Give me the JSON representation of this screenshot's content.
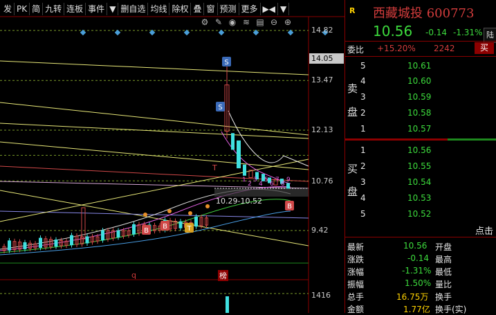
{
  "toolbar": {
    "items": [
      "发",
      "PK",
      "简",
      "九转",
      "连板",
      "事件",
      "▼",
      "删自选",
      "均线",
      "除权",
      "叠",
      "窗",
      "预测",
      "更多",
      "▶◀",
      "▼"
    ]
  },
  "chart_icons": [
    "gear-icon",
    "pen-icon",
    "eye-icon",
    "stack-icon",
    "file-icon",
    "minus-icon",
    "plus-icon"
  ],
  "axis": {
    "price_ticks": [
      {
        "label": "14.82",
        "value": 14.82
      },
      {
        "label": "13.47",
        "value": 13.47
      },
      {
        "label": "12.13",
        "value": 12.13
      },
      {
        "label": "10.76",
        "value": 10.76
      },
      {
        "label": "9.42",
        "value": 9.42
      }
    ],
    "current_price_tag": "14.05",
    "volume_tick": "1416"
  },
  "annotations": {
    "range_text": "10.29-10.52",
    "small_numbers": [
      "1",
      "2",
      "3",
      "4",
      "5",
      "6",
      "7",
      "8",
      "9"
    ],
    "markers": {
      "sell": "S",
      "buy": "B",
      "t_mark": "T",
      "t_red": "T"
    },
    "sub_q": "q",
    "sub_bang": "榜"
  },
  "quote": {
    "badge": "R",
    "name": "西藏城投",
    "code": "600773",
    "price": "10.56",
    "change": "-0.14",
    "change_pct": "-1.31%",
    "lu_button": "陆",
    "weibi_label": "委比",
    "weibi_pct": "+15.20%",
    "weibi_vol": "2242",
    "buy_button": "买",
    "sell_side_chars": [
      "卖",
      "盘"
    ],
    "buy_side_chars": [
      "买",
      "盘"
    ],
    "asks": [
      {
        "level": "5",
        "price": "10.61"
      },
      {
        "level": "4",
        "price": "10.60"
      },
      {
        "level": "3",
        "price": "10.59"
      },
      {
        "level": "2",
        "price": "10.58"
      },
      {
        "level": "1",
        "price": "10.57"
      }
    ],
    "bids": [
      {
        "level": "1",
        "price": "10.56"
      },
      {
        "level": "2",
        "price": "10.55"
      },
      {
        "level": "3",
        "price": "10.54"
      },
      {
        "level": "4",
        "price": "10.53"
      },
      {
        "level": "5",
        "price": "10.52"
      }
    ],
    "diandiji": "点击",
    "stats": [
      {
        "label": "最新",
        "value": "10.56",
        "label2": "开盘"
      },
      {
        "label": "涨跌",
        "value": "-0.14",
        "label2": "最高"
      },
      {
        "label": "涨幅",
        "value": "-1.31%",
        "label2": "最低"
      },
      {
        "label": "振幅",
        "value": "1.50%",
        "label2": "量比"
      },
      {
        "label": "总手",
        "value": "16.75万",
        "label2": "换手"
      },
      {
        "label": "金额",
        "value": "1.77亿",
        "label2": "换手(实)"
      }
    ],
    "colors": {
      "up": "#d23c3c",
      "down": "#3ddc3d",
      "neutral": "#e8e8e8",
      "accent": "#ffd200"
    }
  }
}
